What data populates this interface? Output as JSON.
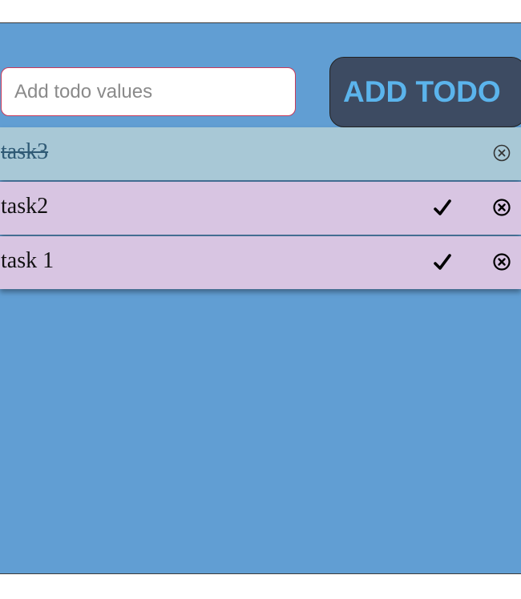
{
  "input": {
    "placeholder": "Add todo values",
    "value": ""
  },
  "add_button": {
    "label": "ADD TODO"
  },
  "todos": [
    {
      "text": "task3",
      "completed": true,
      "check_icon": "",
      "delete_icon": "close-circle-icon"
    },
    {
      "text": "task2",
      "completed": false,
      "check_icon": "checkmark-icon",
      "delete_icon": "close-circle-icon"
    },
    {
      "text": "task 1",
      "completed": false,
      "check_icon": "checkmark-icon",
      "delete_icon": "close-circle-icon"
    }
  ],
  "colors": {
    "background": "#619ed3",
    "completed_row": "#a8c8d6",
    "pending_row": "#d8c5e2",
    "button_bg": "#3d4b62",
    "button_text": "#5bb4ec",
    "input_border": "#c93a5a"
  }
}
